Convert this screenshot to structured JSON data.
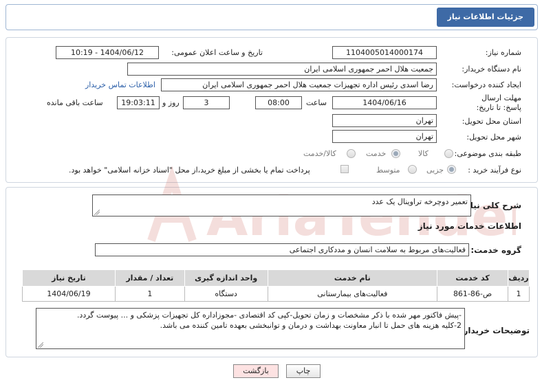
{
  "header": {
    "title": "جزئیات اطلاعات نیاز"
  },
  "form": {
    "need_number": {
      "label": "شماره نیاز:",
      "value": "1104005014000174"
    },
    "announce": {
      "label": "تاریخ و ساعت اعلان عمومی:",
      "value": "1404/06/12 - 10:19"
    },
    "buyer_org": {
      "label": "نام دستگاه خریدار:",
      "value": "جمعیت هلال احمر جمهوری اسلامی ایران"
    },
    "creator": {
      "label": "ایجاد کننده درخواست:",
      "value": "رضا اسدی رئیس اداره تجهیزات جمعیت هلال احمر جمهوری اسلامی ایران",
      "contact_link": "اطلاعات تماس خریدار"
    },
    "deadline": {
      "label": "مهلت ارسال پاسخ: تا تاریخ:",
      "date": "1404/06/16",
      "time_label": "ساعت",
      "time": "08:00",
      "days": "3",
      "days_label": "روز و",
      "remaining": "19:03:11",
      "remaining_label": "ساعت باقی مانده"
    },
    "province": {
      "label": "استان محل تحویل:",
      "value": "تهران"
    },
    "city": {
      "label": "شهر محل تحویل:",
      "value": "تهران"
    },
    "category": {
      "label": "طبقه بندی موضوعی:",
      "options": [
        "کالا",
        "خدمت",
        "کالا/خدمت"
      ],
      "selected": "خدمت"
    },
    "process": {
      "label": "نوع فرآیند خرید :",
      "options": [
        "جزیی",
        "متوسط"
      ],
      "selected": "جزیی",
      "payment_note": "پرداخت تمام یا بخشی از مبلغ خرید،از محل \"اسناد خزانه اسلامی\" خواهد بود."
    }
  },
  "summary": {
    "label": "شرح کلی نیاز:",
    "value": "تعمیر دوچرخه تراوینال یک عدد"
  },
  "services_info": {
    "title": "اطلاعات خدمات مورد نیاز",
    "group_label": "گروه خدمت:",
    "group_value": "فعالیت‌های مربوط به سلامت انسان و مددکاری اجتماعی"
  },
  "table": {
    "headers": [
      "ردیف",
      "کد خدمت",
      "نام خدمت",
      "واحد اندازه گیری",
      "تعداد / مقدار",
      "تاریخ نیاز"
    ],
    "rows": [
      [
        "1",
        "ص-86-861",
        "فعالیت‌های بیمارستانی",
        "دستگاه",
        "1",
        "1404/06/19"
      ]
    ]
  },
  "buyer_notes": {
    "label": "توضیحات خریدار:",
    "lines": [
      "-پیش فاکتور مهر شده با ذکر مشخصات و زمان تحویل-کپی کد اقتصادی -مجوزاداره کل تجهیزات پزشکی و ... پیوست گردد.",
      "2-کلیه هزینه های حمل تا انبار معاونت بهداشت و درمان و توانبخشی بعهده تامین کننده می باشد."
    ]
  },
  "buttons": {
    "print": "چاپ",
    "back": "بازگشت"
  },
  "watermark": {
    "text": "AriaTender.neT"
  },
  "colors": {
    "header_bg": "#3e6aa6",
    "link": "#2a5ea8",
    "back_button_bg": "#fde2e2",
    "watermark": "#c0392b"
  }
}
